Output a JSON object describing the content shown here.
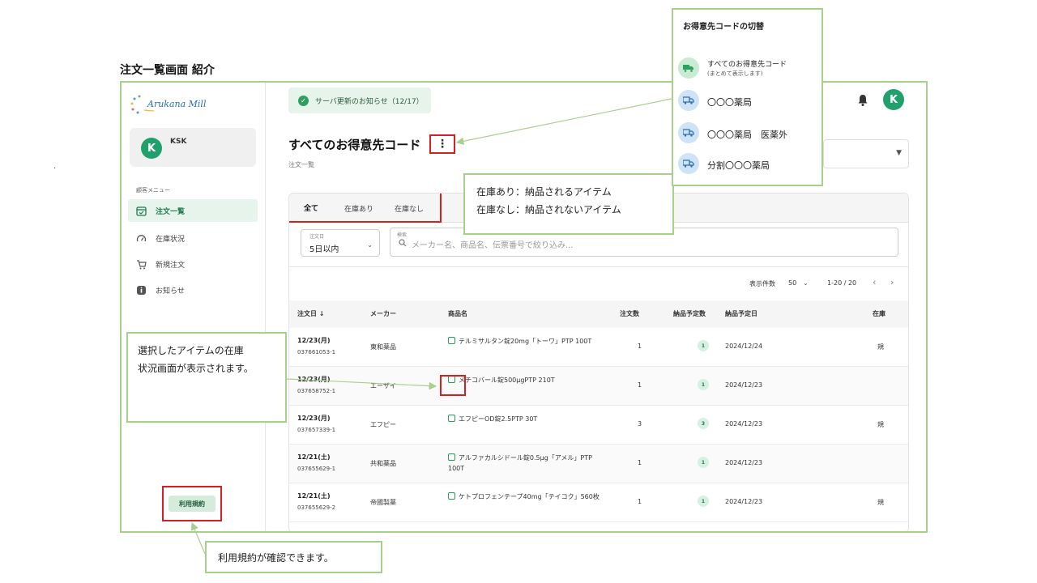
{
  "slide": {
    "title": "注文一覧画面 紹介",
    "dot": "."
  },
  "sidebar": {
    "logo_text": "Arukana Mill",
    "user": {
      "initial": "K",
      "name": "KSK"
    },
    "menu_heading": "顧客メニュー",
    "items": [
      {
        "label": "注文一覧",
        "icon": "calendar-check-icon",
        "active": true
      },
      {
        "label": "在庫状況",
        "icon": "gauge-icon",
        "active": false
      },
      {
        "label": "新規注文",
        "icon": "cart-icon",
        "active": false
      },
      {
        "label": "お知らせ",
        "icon": "info-icon",
        "active": false
      }
    ],
    "terms_label": "利用規約"
  },
  "header": {
    "notice": "サーバ更新のお知らせ（12/17）",
    "avatar_initial": "K"
  },
  "main": {
    "page_title": "すべてのお得意先コード",
    "more_glyph": "⋮",
    "breadcrumb": "注文一覧",
    "tabs": [
      {
        "label": "全て",
        "active": true
      },
      {
        "label": "在庫あり",
        "active": false
      },
      {
        "label": "在庫なし",
        "active": false
      }
    ],
    "date_filter": {
      "label": "注文日",
      "value": "5日以内"
    },
    "search": {
      "label": "検索",
      "placeholder": "メーカー名、商品名、伝票番号で絞り込み..."
    },
    "pagination": {
      "page_size_label": "表示件数",
      "page_size": "50",
      "range": "1-20 / 20"
    },
    "columns": [
      "注文日 ↓",
      "メーカー",
      "商品名",
      "注文数",
      "納品予定数",
      "納品予定日",
      "在庫"
    ],
    "rows": [
      {
        "date": "12/23(月)",
        "slip": "037661053-1",
        "maker": "東和薬品",
        "product": "テルミサルタン錠20mg「トーワ」PTP 100T",
        "qty": "1",
        "planned": "1",
        "delivery": "2024/12/24",
        "stock": "規"
      },
      {
        "date": "12/23(月)",
        "slip": "037658752-1",
        "maker": "エーザイ",
        "product": "メチコバール錠500μgPTP 210T",
        "qty": "1",
        "planned": "1",
        "delivery": "2024/12/23",
        "stock": ""
      },
      {
        "date": "12/23(月)",
        "slip": "037657339-1",
        "maker": "エフピー",
        "product": "エフピーOD錠2.5PTP 30T",
        "qty": "3",
        "planned": "3",
        "delivery": "2024/12/23",
        "stock": "規"
      },
      {
        "date": "12/21(土)",
        "slip": "037655629-1",
        "maker": "共和薬品",
        "product": "アルファカルシドール錠0.5μg「アメル」PTP 100T",
        "qty": "1",
        "planned": "1",
        "delivery": "2024/12/23",
        "stock": ""
      },
      {
        "date": "12/21(土)",
        "slip": "037655629-2",
        "maker": "帝國製薬",
        "product": "ケトプロフェンテープ40mg「テイコク」560枚",
        "qty": "1",
        "planned": "1",
        "delivery": "2024/12/23",
        "stock": "規"
      }
    ]
  },
  "code_panel": {
    "title": "お得意先コードの切替",
    "all_label": "すべてのお得意先コード",
    "all_sub": "(まとめて表示します)",
    "items": [
      "〇〇〇薬局",
      "〇〇〇薬局　医薬外",
      "分割〇〇〇薬局"
    ],
    "icon": "truck-icon"
  },
  "callouts": {
    "stock_line1": "在庫あり：納品されるアイテム",
    "stock_line2": "在庫なし：納品されないアイテム",
    "status_line1": "選択したアイテムの在庫",
    "status_line2": "状況画面が表示されます。",
    "terms": "利用規約が確認できます。"
  },
  "colors": {
    "accent": "#1f7a4d",
    "callout_border": "#a8d08d",
    "highlight": "#d42020"
  }
}
